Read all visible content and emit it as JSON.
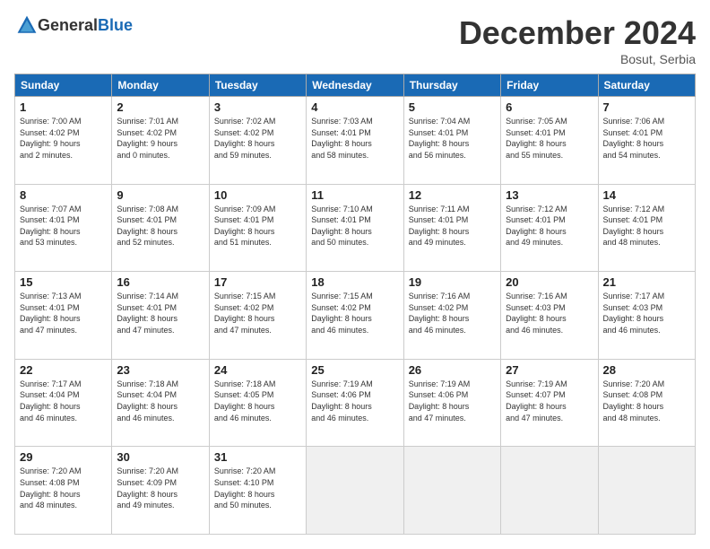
{
  "header": {
    "logo_general": "General",
    "logo_blue": "Blue",
    "title": "December 2024",
    "location": "Bosut, Serbia"
  },
  "weekdays": [
    "Sunday",
    "Monday",
    "Tuesday",
    "Wednesday",
    "Thursday",
    "Friday",
    "Saturday"
  ],
  "weeks": [
    [
      {
        "day": "1",
        "lines": [
          "Sunrise: 7:00 AM",
          "Sunset: 4:02 PM",
          "Daylight: 9 hours",
          "and 2 minutes."
        ]
      },
      {
        "day": "2",
        "lines": [
          "Sunrise: 7:01 AM",
          "Sunset: 4:02 PM",
          "Daylight: 9 hours",
          "and 0 minutes."
        ]
      },
      {
        "day": "3",
        "lines": [
          "Sunrise: 7:02 AM",
          "Sunset: 4:02 PM",
          "Daylight: 8 hours",
          "and 59 minutes."
        ]
      },
      {
        "day": "4",
        "lines": [
          "Sunrise: 7:03 AM",
          "Sunset: 4:01 PM",
          "Daylight: 8 hours",
          "and 58 minutes."
        ]
      },
      {
        "day": "5",
        "lines": [
          "Sunrise: 7:04 AM",
          "Sunset: 4:01 PM",
          "Daylight: 8 hours",
          "and 56 minutes."
        ]
      },
      {
        "day": "6",
        "lines": [
          "Sunrise: 7:05 AM",
          "Sunset: 4:01 PM",
          "Daylight: 8 hours",
          "and 55 minutes."
        ]
      },
      {
        "day": "7",
        "lines": [
          "Sunrise: 7:06 AM",
          "Sunset: 4:01 PM",
          "Daylight: 8 hours",
          "and 54 minutes."
        ]
      }
    ],
    [
      {
        "day": "8",
        "lines": [
          "Sunrise: 7:07 AM",
          "Sunset: 4:01 PM",
          "Daylight: 8 hours",
          "and 53 minutes."
        ]
      },
      {
        "day": "9",
        "lines": [
          "Sunrise: 7:08 AM",
          "Sunset: 4:01 PM",
          "Daylight: 8 hours",
          "and 52 minutes."
        ]
      },
      {
        "day": "10",
        "lines": [
          "Sunrise: 7:09 AM",
          "Sunset: 4:01 PM",
          "Daylight: 8 hours",
          "and 51 minutes."
        ]
      },
      {
        "day": "11",
        "lines": [
          "Sunrise: 7:10 AM",
          "Sunset: 4:01 PM",
          "Daylight: 8 hours",
          "and 50 minutes."
        ]
      },
      {
        "day": "12",
        "lines": [
          "Sunrise: 7:11 AM",
          "Sunset: 4:01 PM",
          "Daylight: 8 hours",
          "and 49 minutes."
        ]
      },
      {
        "day": "13",
        "lines": [
          "Sunrise: 7:12 AM",
          "Sunset: 4:01 PM",
          "Daylight: 8 hours",
          "and 49 minutes."
        ]
      },
      {
        "day": "14",
        "lines": [
          "Sunrise: 7:12 AM",
          "Sunset: 4:01 PM",
          "Daylight: 8 hours",
          "and 48 minutes."
        ]
      }
    ],
    [
      {
        "day": "15",
        "lines": [
          "Sunrise: 7:13 AM",
          "Sunset: 4:01 PM",
          "Daylight: 8 hours",
          "and 47 minutes."
        ]
      },
      {
        "day": "16",
        "lines": [
          "Sunrise: 7:14 AM",
          "Sunset: 4:01 PM",
          "Daylight: 8 hours",
          "and 47 minutes."
        ]
      },
      {
        "day": "17",
        "lines": [
          "Sunrise: 7:15 AM",
          "Sunset: 4:02 PM",
          "Daylight: 8 hours",
          "and 47 minutes."
        ]
      },
      {
        "day": "18",
        "lines": [
          "Sunrise: 7:15 AM",
          "Sunset: 4:02 PM",
          "Daylight: 8 hours",
          "and 46 minutes."
        ]
      },
      {
        "day": "19",
        "lines": [
          "Sunrise: 7:16 AM",
          "Sunset: 4:02 PM",
          "Daylight: 8 hours",
          "and 46 minutes."
        ]
      },
      {
        "day": "20",
        "lines": [
          "Sunrise: 7:16 AM",
          "Sunset: 4:03 PM",
          "Daylight: 8 hours",
          "and 46 minutes."
        ]
      },
      {
        "day": "21",
        "lines": [
          "Sunrise: 7:17 AM",
          "Sunset: 4:03 PM",
          "Daylight: 8 hours",
          "and 46 minutes."
        ]
      }
    ],
    [
      {
        "day": "22",
        "lines": [
          "Sunrise: 7:17 AM",
          "Sunset: 4:04 PM",
          "Daylight: 8 hours",
          "and 46 minutes."
        ]
      },
      {
        "day": "23",
        "lines": [
          "Sunrise: 7:18 AM",
          "Sunset: 4:04 PM",
          "Daylight: 8 hours",
          "and 46 minutes."
        ]
      },
      {
        "day": "24",
        "lines": [
          "Sunrise: 7:18 AM",
          "Sunset: 4:05 PM",
          "Daylight: 8 hours",
          "and 46 minutes."
        ]
      },
      {
        "day": "25",
        "lines": [
          "Sunrise: 7:19 AM",
          "Sunset: 4:06 PM",
          "Daylight: 8 hours",
          "and 46 minutes."
        ]
      },
      {
        "day": "26",
        "lines": [
          "Sunrise: 7:19 AM",
          "Sunset: 4:06 PM",
          "Daylight: 8 hours",
          "and 47 minutes."
        ]
      },
      {
        "day": "27",
        "lines": [
          "Sunrise: 7:19 AM",
          "Sunset: 4:07 PM",
          "Daylight: 8 hours",
          "and 47 minutes."
        ]
      },
      {
        "day": "28",
        "lines": [
          "Sunrise: 7:20 AM",
          "Sunset: 4:08 PM",
          "Daylight: 8 hours",
          "and 48 minutes."
        ]
      }
    ],
    [
      {
        "day": "29",
        "lines": [
          "Sunrise: 7:20 AM",
          "Sunset: 4:08 PM",
          "Daylight: 8 hours",
          "and 48 minutes."
        ]
      },
      {
        "day": "30",
        "lines": [
          "Sunrise: 7:20 AM",
          "Sunset: 4:09 PM",
          "Daylight: 8 hours",
          "and 49 minutes."
        ]
      },
      {
        "day": "31",
        "lines": [
          "Sunrise: 7:20 AM",
          "Sunset: 4:10 PM",
          "Daylight: 8 hours",
          "and 50 minutes."
        ]
      },
      null,
      null,
      null,
      null
    ]
  ]
}
